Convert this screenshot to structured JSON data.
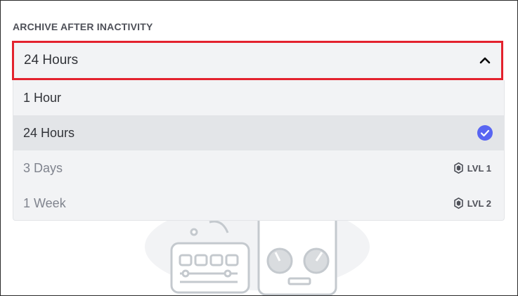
{
  "section": {
    "label": "ARCHIVE AFTER INACTIVITY"
  },
  "select": {
    "value": "24 Hours",
    "icon": "chevron-up-icon",
    "highlight_color": "#e3222d"
  },
  "options": [
    {
      "label": "1 Hour",
      "selected": false,
      "locked": false
    },
    {
      "label": "24 Hours",
      "selected": true,
      "locked": false,
      "icon": "check-circle-icon",
      "icon_color": "#5865f2"
    },
    {
      "label": "3 Days",
      "selected": false,
      "locked": true,
      "badge": "LVL 1",
      "icon": "boost-gem-icon"
    },
    {
      "label": "1 Week",
      "selected": false,
      "locked": true,
      "badge": "LVL 2",
      "icon": "boost-gem-icon"
    }
  ]
}
